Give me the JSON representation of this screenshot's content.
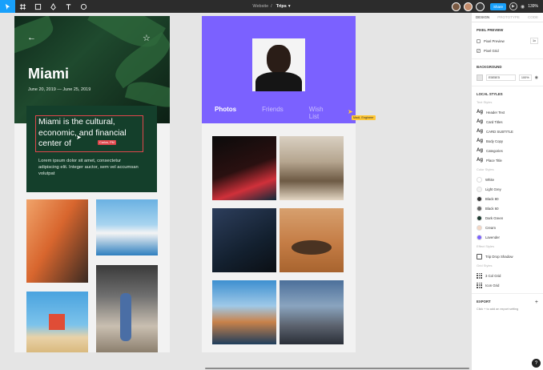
{
  "toolbar": {
    "doc_project": "Website",
    "doc_separator": "/",
    "doc_page": "Trips",
    "share_label": "Share",
    "zoom_label": "139%"
  },
  "miami": {
    "title": "Miami",
    "dates": "June 20, 2019 — June 25, 2019",
    "heading": "Miami is the cultural, economic, and financial center of",
    "body": "Lorem ipsum dolor sit amet, consectetur adipiscing elit. Integer auctor, sem vel accumsan volutpat",
    "cursor_label": "Carlos, PM"
  },
  "profile": {
    "tabs": [
      "Photos",
      "Friends",
      "Wish List"
    ],
    "cursor_label": "Madi, Engineer"
  },
  "panel": {
    "tabs": [
      "DESIGN",
      "PROTOTYPE",
      "CODE"
    ],
    "pixel_preview": {
      "title": "PIXEL PREVIEW",
      "pixel_preview_label": "Pixel Preview",
      "pixel_preview_value": "1x",
      "pixel_grid_label": "Pixel Grid"
    },
    "background": {
      "title": "BACKGROUND",
      "hex": "E5E5E5",
      "opacity": "100%"
    },
    "local_styles": {
      "title": "LOCAL STYLES",
      "text_styles_title": "Text Styles",
      "text_styles": [
        "Header Text",
        "Card Titles",
        "CARD SUBTITLE",
        "Body Copy",
        "Categories",
        "Place Title"
      ],
      "color_styles_title": "Color Styles",
      "colors": [
        {
          "name": "White",
          "color": "#ffffff"
        },
        {
          "name": "Light Grey",
          "color": "#f2f2f2"
        },
        {
          "name": "Black 80",
          "color": "#333333"
        },
        {
          "name": "Black 60",
          "color": "#666666"
        },
        {
          "name": "Dark Green",
          "color": "#1e3a2f"
        },
        {
          "name": "Cream",
          "color": "#f3d6c4"
        },
        {
          "name": "Lavender",
          "color": "#7b61ff"
        }
      ],
      "effect_styles_title": "Effect Styles",
      "effect": "Trip Drop Shadow",
      "grid_styles_title": "Grid Styles",
      "grids": [
        "3 Col Grid",
        "Icon Grid"
      ]
    },
    "export": {
      "title": "EXPORT",
      "hint": "Click + to add an export setting",
      "add_symbol": "+"
    },
    "help_symbol": "?"
  }
}
